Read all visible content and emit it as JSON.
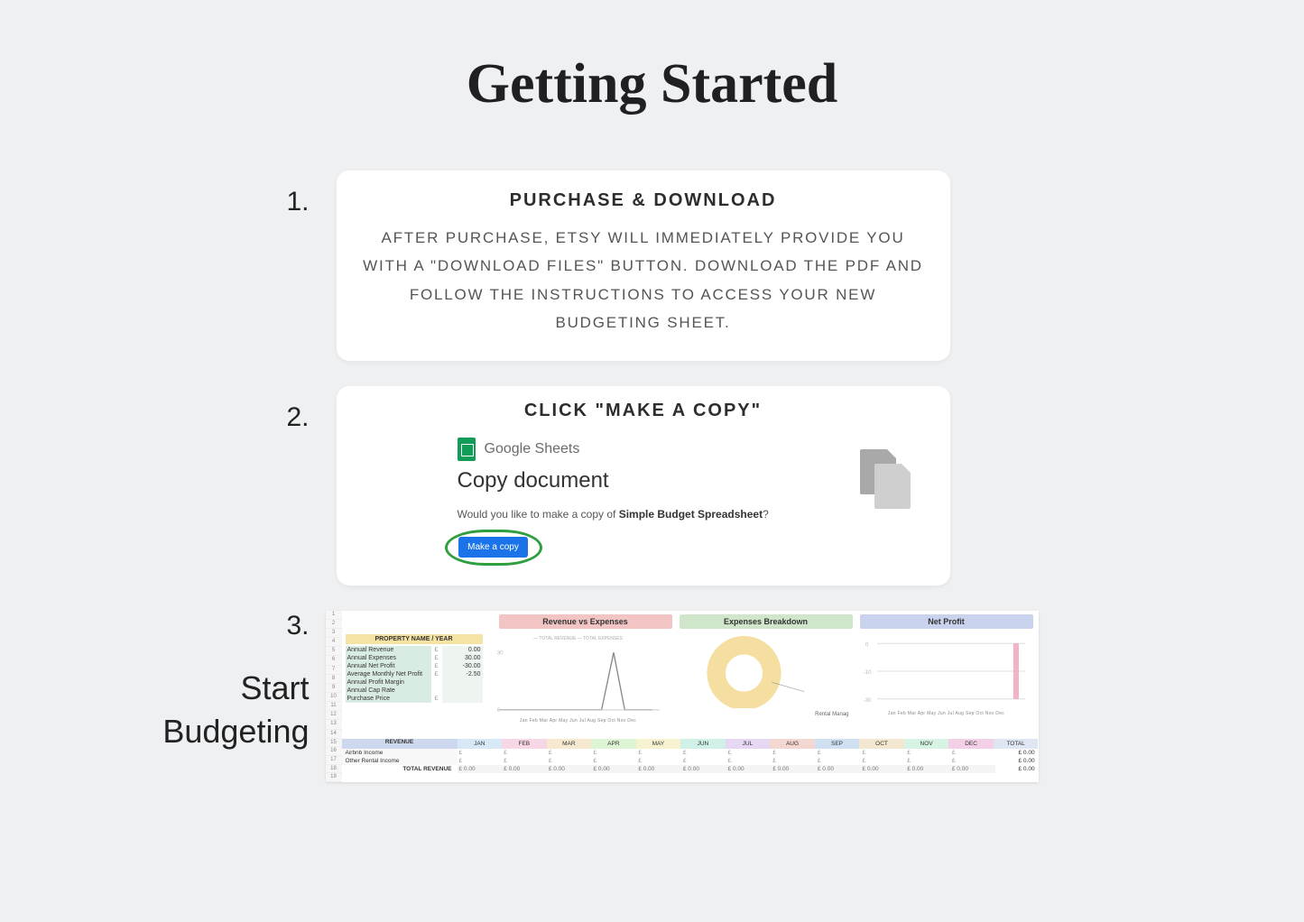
{
  "title": "Getting Started",
  "steps": {
    "s1": {
      "num": "1.",
      "title": "PURCHASE & DOWNLOAD",
      "body": "AFTER PURCHASE, ETSY WILL IMMEDIATELY PROVIDE YOU WITH A \"DOWNLOAD FILES\" BUTTON. DOWNLOAD THE PDF AND FOLLOW THE INSTRUCTIONS TO ACCESS YOUR NEW BUDGETING SHEET."
    },
    "s2": {
      "num": "2.",
      "title": "CLICK \"MAKE A COPY\"",
      "gs_label": "Google Sheets",
      "copy_heading": "Copy document",
      "copy_q_prefix": "Would you like to make a copy of ",
      "copy_q_name": "Simple Budget Spreadsheet",
      "copy_q_suffix": "?",
      "btn": "Make a copy"
    },
    "s3": {
      "num": "3.",
      "line1": "Start",
      "line2": "Budgeting"
    }
  },
  "sheet": {
    "prop_header": "PROPERTY NAME / YEAR",
    "rev_header": "REVENUE",
    "chart_titles": {
      "rev": "Revenue vs Expenses",
      "exp": "Expenses Breakdown",
      "net": "Net Profit"
    },
    "legend_rev": "— TOTAL REVENUE    — TOTAL EXPENSES",
    "exp_label": "Rental Manag",
    "months_short": "Jan Feb Mar Apr May Jun Jul Aug Sep Oct Nov Dec",
    "summary": [
      {
        "label": "Annual Revenue",
        "cur": "£",
        "val": "0.00"
      },
      {
        "label": "Annual Expenses",
        "cur": "£",
        "val": "30.00"
      },
      {
        "label": "Annual Net Profit",
        "cur": "£",
        "val": "-30.00"
      },
      {
        "label": "Average Monthly Net Profit",
        "cur": "£",
        "val": "-2.50"
      },
      {
        "label": "Annual Profit Margin",
        "cur": "",
        "val": ""
      },
      {
        "label": "Annual Cap Rate",
        "cur": "",
        "val": ""
      },
      {
        "label": "Purchase Price",
        "cur": "£",
        "val": ""
      }
    ],
    "month_labels": [
      "JAN",
      "FEB",
      "MAR",
      "APR",
      "MAY",
      "JUN",
      "JUL",
      "AUG",
      "SEP",
      "OCT",
      "NOV",
      "DEC",
      "TOTAL"
    ],
    "rows": [
      {
        "label": "Airbnb Income",
        "cells": [
          "£",
          "£",
          "£",
          "£",
          "£",
          "£",
          "£",
          "£",
          "£",
          "£",
          "£",
          "£"
        ],
        "total": "£    0.00"
      },
      {
        "label": "Other Rental Income",
        "cells": [
          "£",
          "£",
          "£",
          "£",
          "£",
          "£",
          "£",
          "£",
          "£",
          "£",
          "£",
          "£"
        ],
        "total": "£    0.00"
      }
    ],
    "total_row": {
      "label": "TOTAL REVENUE",
      "cells": [
        "£   0.00",
        "£   0.00",
        "£   0.00",
        "£   0.00",
        "£   0.00",
        "£   0.00",
        "£   0.00",
        "£   0.00",
        "£   0.00",
        "£   0.00",
        "£   0.00",
        "£   0.00"
      ],
      "total": "£    0.00"
    }
  }
}
